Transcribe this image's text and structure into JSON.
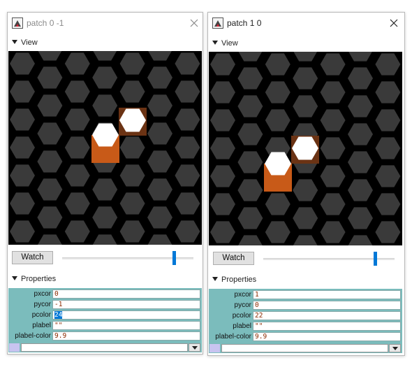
{
  "windows": [
    {
      "title": "patch 0 -1",
      "active": false,
      "view_label": "View",
      "watch_label": "Watch",
      "slider": 0.85,
      "properties_label": "Properties",
      "properties": [
        {
          "name": "pxcor",
          "value": "0"
        },
        {
          "name": "pycor",
          "value": "-1"
        },
        {
          "name": "pcolor",
          "value": "24",
          "selected": true
        },
        {
          "name": "plabel",
          "value": "\"\""
        },
        {
          "name": "plabel-color",
          "value": "9.9"
        }
      ]
    },
    {
      "title": "patch 1 0",
      "active": true,
      "view_label": "View",
      "watch_label": "Watch",
      "slider": 0.85,
      "properties_label": "Properties",
      "properties": [
        {
          "name": "pxcor",
          "value": "1"
        },
        {
          "name": "pycor",
          "value": "0"
        },
        {
          "name": "pcolor",
          "value": "22"
        },
        {
          "name": "plabel",
          "value": "\"\""
        },
        {
          "name": "plabel-color",
          "value": "9.9"
        }
      ]
    }
  ],
  "colors": {
    "view_background": "#000000",
    "hex_cell": "#3a3a3a",
    "highlight_hex": "#ffffff",
    "orange_patch": "#c85a18",
    "brown_patch": "#6b3314",
    "properties_bg": "#7bbcbc",
    "slider_thumb": "#0078d7"
  },
  "icons": [
    "netlogo-app-icon",
    "close-icon",
    "triangle-down-icon",
    "dropdown-icon"
  ]
}
